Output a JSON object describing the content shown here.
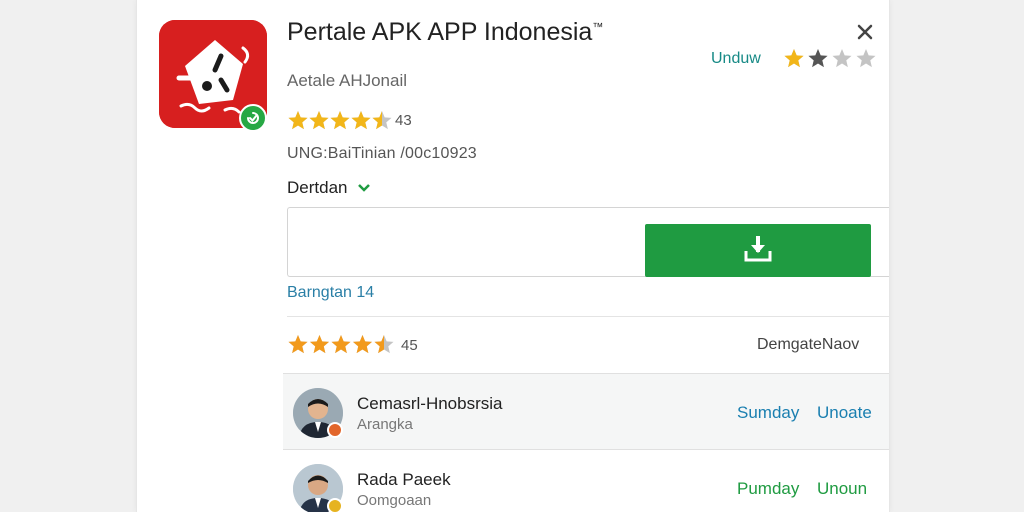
{
  "app": {
    "title": "Pertale APK APP Indonesia",
    "title_mark": "™",
    "developer": "Aetale  AHJonail",
    "rating_count": "43",
    "version": "UNG:BaiTinian /00c10923"
  },
  "header": {
    "action_label": "Unduw",
    "stars": {
      "rating": 2,
      "max": 4
    }
  },
  "section": {
    "dropdown_label": "Dertdan"
  },
  "download": {
    "input_value": ""
  },
  "link": {
    "label": "Barngtan 14"
  },
  "reviews": {
    "rating": 4.5,
    "max": 5,
    "count": "45",
    "sort_label": "DemgateNaov",
    "items": [
      {
        "name": "Cemasrl-Hnobsrsia",
        "subtitle": "Arangka",
        "action_a": "Sumday",
        "action_b": "Unoate",
        "action_color": "#1a7fb0",
        "badge_color": "#e2662b"
      },
      {
        "name": "Rada Paeek",
        "subtitle": "Oomgoaan",
        "action_a": "Pumday",
        "action_b": "Unoun",
        "action_color": "#1f9b41",
        "badge_color": "#e6b320"
      }
    ]
  },
  "colors": {
    "brand_red": "#d71f1f",
    "download_green": "#1f9b41",
    "teal": "#178a86",
    "star_gold": "#f2b619",
    "star_gray": "#c4c4c4"
  },
  "icons": {
    "app": "app-logo-icon",
    "verify": "verified-check-icon",
    "close": "close-icon",
    "download": "download-tray-icon",
    "dropdown": "chevron-down-icon"
  }
}
